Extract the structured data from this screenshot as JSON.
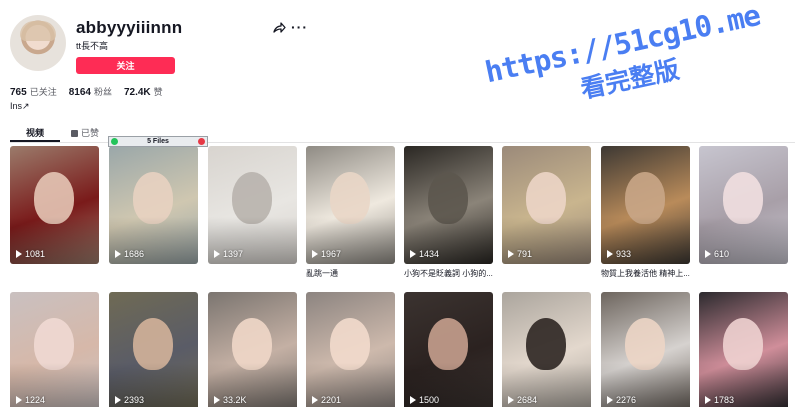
{
  "profile": {
    "username": "abbyyyiiinnn",
    "subtitle": "tt長不高",
    "follow_label": "关注",
    "bio": "Ins↗"
  },
  "stats": [
    {
      "value": "765",
      "label": "已关注"
    },
    {
      "value": "8164",
      "label": "粉丝"
    },
    {
      "value": "72.4K",
      "label": "赞"
    }
  ],
  "tabs": [
    {
      "label": "视频",
      "active": true
    },
    {
      "label": "已赞",
      "active": false
    }
  ],
  "watermark": {
    "line1": "https://51cg10.me",
    "line2": "看完整版",
    "color": "#4a7ef2"
  },
  "overlay_badge": {
    "label": "5 Files"
  },
  "videos_row1": [
    {
      "views": "1081",
      "caption": "",
      "colors": [
        "#9b7b6b",
        "#e6c6b6",
        "#7a1a1a"
      ]
    },
    {
      "views": "1686",
      "caption": "",
      "colors": [
        "#9aa7a9",
        "#e8d2c1",
        "#cfc7b0"
      ]
    },
    {
      "views": "1397",
      "caption": "",
      "colors": [
        "#d8d4cf",
        "#b8b3ad",
        "#e8e6e2"
      ]
    },
    {
      "views": "1967",
      "caption": "亂跳一通",
      "colors": [
        "#8f8b84",
        "#e9d6c7",
        "#efe9df"
      ]
    },
    {
      "views": "1434",
      "caption": "小狗不是貶義詞 小狗的...",
      "colors": [
        "#2a2723",
        "#5c564e",
        "#8b8479"
      ]
    },
    {
      "views": "791",
      "caption": "",
      "colors": [
        "#9b8a7a",
        "#ecd5c6",
        "#c9b58e"
      ]
    },
    {
      "views": "933",
      "caption": "物質上我養活他 精神上...",
      "colors": [
        "#3d3833",
        "#c9a687",
        "#b98b5a"
      ]
    },
    {
      "views": "610",
      "caption": "",
      "colors": [
        "#c7c5cf",
        "#f1dfe0",
        "#a89fa8"
      ]
    }
  ],
  "videos_row2": [
    {
      "views": "1224",
      "colors": [
        "#c9c0c0",
        "#efd9d3",
        "#d6b8a9"
      ]
    },
    {
      "views": "2393",
      "colors": [
        "#6f6a54",
        "#d3b39a",
        "#5a5c67"
      ]
    },
    {
      "views": "33.2K",
      "colors": [
        "#7b7570",
        "#f0d7c8",
        "#c4b0a4"
      ]
    },
    {
      "views": "2201",
      "colors": [
        "#8c8480",
        "#f2dacc",
        "#cdb9ac"
      ]
    },
    {
      "views": "1500",
      "colors": [
        "#3b3330",
        "#c7a08e",
        "#2b2220"
      ]
    },
    {
      "views": "2684",
      "colors": [
        "#aba59d",
        "#2e2622",
        "#e3d8cd"
      ]
    },
    {
      "views": "2276",
      "colors": [
        "#6d655e",
        "#ecd5c5",
        "#d6d2cf"
      ]
    },
    {
      "views": "1783",
      "colors": [
        "#2c2a2e",
        "#eed2d0",
        "#d08e9a"
      ]
    }
  ]
}
